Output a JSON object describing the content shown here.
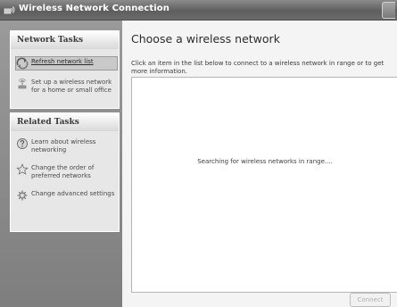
{
  "window": {
    "title": "Wireless Network Connection"
  },
  "sidebar": {
    "network_tasks": {
      "title": "Network Tasks",
      "items": [
        {
          "label": "Refresh network list",
          "icon": "refresh-icon"
        },
        {
          "label": "Set up a wireless network for a home or small office",
          "icon": "setup-network-icon"
        }
      ]
    },
    "related_tasks": {
      "title": "Related Tasks",
      "items": [
        {
          "label": "Learn about wireless networking",
          "icon": "help-icon"
        },
        {
          "label": "Change the order of preferred networks",
          "icon": "star-icon"
        },
        {
          "label": "Change advanced settings",
          "icon": "settings-icon"
        }
      ]
    }
  },
  "main": {
    "heading": "Choose a wireless network",
    "instructions": "Click an item in the list below to connect to a wireless network in range or to get more information.",
    "status": "Searching for wireless networks in range....",
    "connect_label": "Connect"
  }
}
